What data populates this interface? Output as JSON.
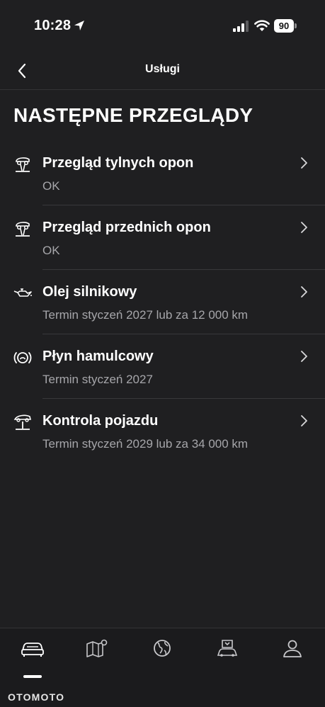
{
  "status_bar": {
    "time": "10:28",
    "battery": "90"
  },
  "header": {
    "title": "Usługi"
  },
  "section": {
    "title": "NASTĘPNE PRZEGLĄDY"
  },
  "services": [
    {
      "icon": "tire-lift-icon",
      "title": "Przegląd tylnych opon",
      "subtitle": "OK"
    },
    {
      "icon": "tire-lift-icon",
      "title": "Przegląd przednich opon",
      "subtitle": "OK"
    },
    {
      "icon": "oil-can-icon",
      "title": "Olej silnikowy",
      "subtitle": "Termin styczeń 2027 lub za 12 000 km"
    },
    {
      "icon": "brake-warning-icon",
      "title": "Płyn hamulcowy",
      "subtitle": "Termin styczeń 2027"
    },
    {
      "icon": "car-lift-icon",
      "title": "Kontrola pojazdu",
      "subtitle": "Termin styczeń 2029 lub za 34 000 km"
    }
  ],
  "tabs": [
    {
      "icon": "car-icon",
      "active": true
    },
    {
      "icon": "map-pin-icon",
      "active": false
    },
    {
      "icon": "globe-icon",
      "active": false
    },
    {
      "icon": "car-service-icon",
      "active": false
    },
    {
      "icon": "profile-icon",
      "active": false
    }
  ],
  "watermark": "OTOMOTO",
  "colors": {
    "background": "#1f1f21",
    "text_primary": "#ffffff",
    "text_secondary": "#a6a6aa",
    "divider": "#38383b"
  }
}
